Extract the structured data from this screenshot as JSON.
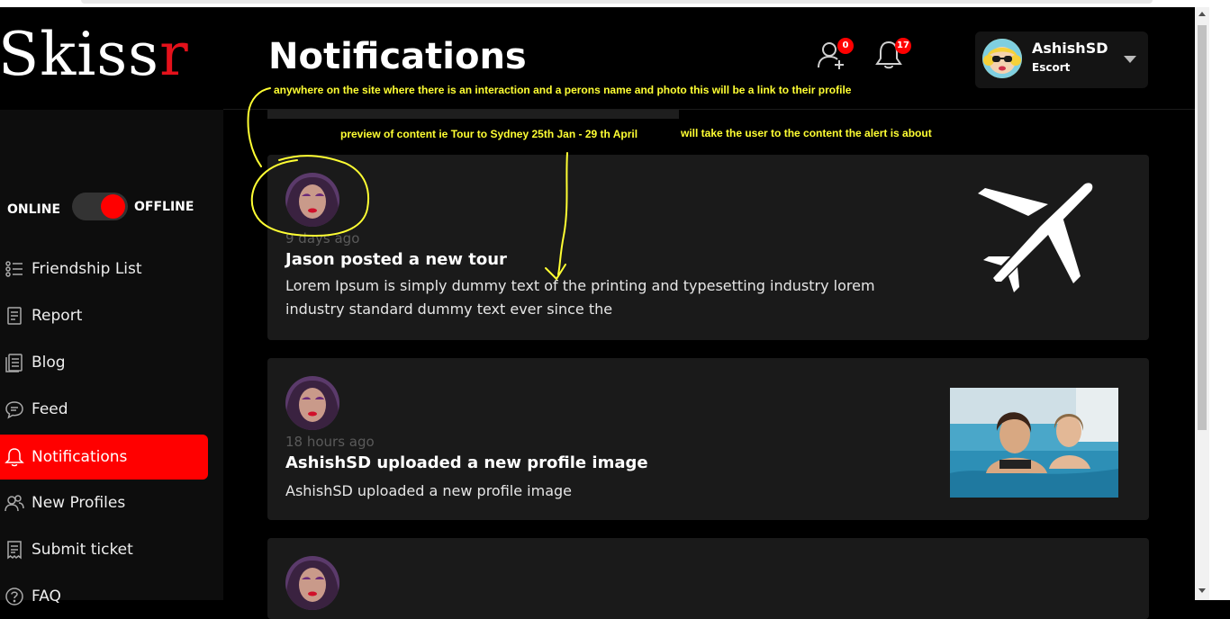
{
  "app": {
    "logo_main": "Skiss",
    "logo_accent": "r"
  },
  "header": {
    "title": "Notifications",
    "friend_requests_count": "0",
    "notifications_count": "17",
    "user": {
      "name": "AshishSD",
      "role": "Escort"
    }
  },
  "sidebar": {
    "status_online": "ONLINE",
    "status_offline": "OFFLINE",
    "items": [
      {
        "label": "Friendship List",
        "icon": "list-icon"
      },
      {
        "label": "Report",
        "icon": "report-icon"
      },
      {
        "label": "Blog",
        "icon": "blog-icon"
      },
      {
        "label": "Feed",
        "icon": "chat-icon"
      },
      {
        "label": "Notifications",
        "icon": "bell-icon",
        "active": true
      },
      {
        "label": "New Profiles",
        "icon": "users-icon"
      },
      {
        "label": "Submit ticket",
        "icon": "ticket-icon"
      },
      {
        "label": "FAQ",
        "icon": "help-icon"
      }
    ]
  },
  "annotations": {
    "profile_link_note": "anywhere on the site where there is an interaction and a perons name and photo this will be a link to their profile",
    "preview_note": "preview of content ie Tour to Sydney 25th Jan - 29 th April",
    "content_link_note": "will take the user to the content the alert is about"
  },
  "notifications": [
    {
      "time": "9 days ago",
      "title": "Jason posted a new tour",
      "text_line1": "Lorem Ipsum is simply dummy text of the printing and typesetting industry lorem",
      "text_line2": "industry standard dummy text ever since the",
      "thumb": "airplane-icon"
    },
    {
      "time": "18 hours ago",
      "title": "AshishSD uploaded a new profile image",
      "text_line1": "AshishSD uploaded a new profile image",
      "thumb": "pool-photo"
    }
  ],
  "colors": {
    "accent": "#ff0000",
    "card_bg": "#1a1a1a",
    "annotation": "#ffff33"
  }
}
